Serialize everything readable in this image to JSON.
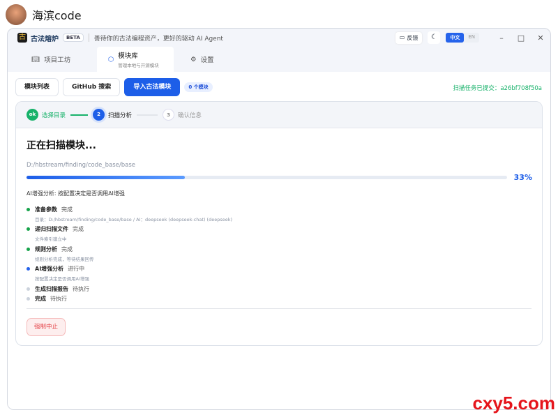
{
  "user": {
    "name": "海滨code"
  },
  "app": {
    "logo_glyph": "古",
    "name": "古法熔炉",
    "badge": "BETA",
    "tagline": "善待你的古法编程资产，更好的驱动 AI Agent",
    "feedback": "反馈",
    "lang_zh": "中文",
    "lang_en": "EN"
  },
  "tabs": [
    {
      "label": "项目工坊"
    },
    {
      "label": "模块库",
      "sub": "管理本地与开源模块"
    },
    {
      "label": "设置"
    }
  ],
  "toolbar": {
    "list": "模块列表",
    "github": "GitHub 搜索",
    "import": "导入古法模块",
    "count": "0 个模块",
    "task": "扫描任务已提交：a26bf708f50a"
  },
  "steps": [
    {
      "mark": "ok",
      "label": "选择目录",
      "state": "done"
    },
    {
      "mark": "2",
      "label": "扫描分析",
      "state": "active"
    },
    {
      "mark": "3",
      "label": "确认信息",
      "state": "pending"
    }
  ],
  "scan": {
    "title": "正在扫描模块...",
    "path": "D:/hbstream/finding/code_base/base",
    "progress": 33,
    "progress_label": "33%",
    "info": "AI增强分析: 按配置决定是否调用AI增强",
    "items": [
      {
        "name": "准备参数",
        "status": "完成",
        "detail": "目录：D:/hbstream/finding/code_base/base / AI：deepseek (deepseek-chat) (deepseek)",
        "color": "#16a34a"
      },
      {
        "name": "递归扫描文件",
        "status": "完成",
        "detail": "文件索引建立中",
        "color": "#16a34a"
      },
      {
        "name": "规则分析",
        "status": "完成",
        "detail": "规则分析完成，等待结果回传",
        "color": "#16a34a"
      },
      {
        "name": "AI增强分析",
        "status": "进行中",
        "detail": "按配置决定是否调用AI增强",
        "color": "#2563eb"
      },
      {
        "name": "生成扫描报告",
        "status": "待执行",
        "detail": "",
        "color": "#cbd2dc"
      },
      {
        "name": "完成",
        "status": "待执行",
        "detail": "",
        "color": "#cbd2dc"
      }
    ],
    "stop": "强制中止"
  },
  "watermark": "cxy5.com"
}
